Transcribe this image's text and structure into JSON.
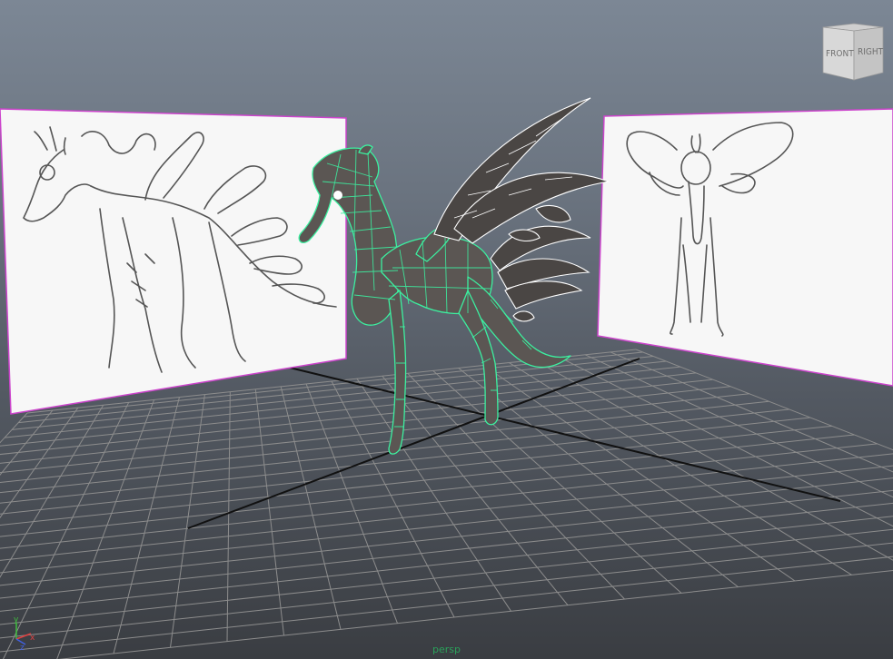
{
  "viewport": {
    "camera_label": "persp",
    "model_wire_color": "#3cf0a0",
    "selection_outline_color": "#cc44cc",
    "grid_color": "#8d8d8d"
  },
  "viewcube": {
    "front_label": "FRONT",
    "right_label": "RIGHT"
  },
  "axis_gizmo": {
    "y_label": "y",
    "x_label": "x",
    "z_label": "z"
  },
  "image_planes": [
    {
      "name": "side-reference-sketch",
      "icon": "seahorse-side-sketch"
    },
    {
      "name": "front-reference-sketch",
      "icon": "seahorse-front-sketch"
    }
  ]
}
